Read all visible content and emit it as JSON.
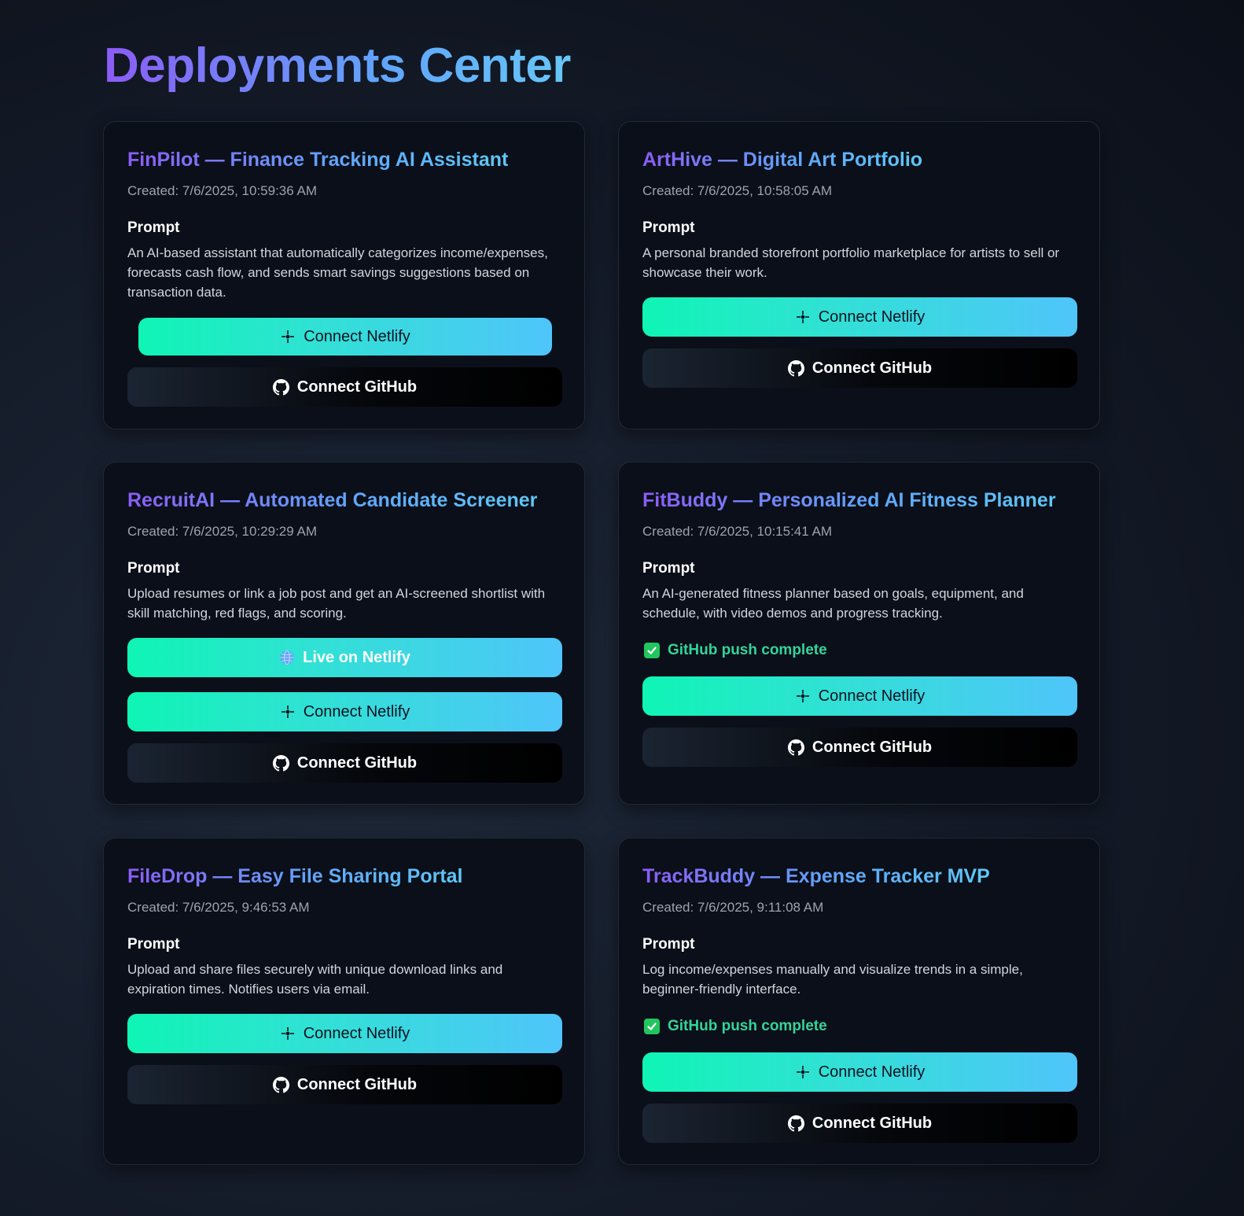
{
  "header": {
    "title": "Deployments Center"
  },
  "labels": {
    "prompt": "Prompt",
    "connect_netlify": "Connect Netlify",
    "connect_github": "Connect GitHub",
    "live_on_netlify": "Live on Netlify",
    "github_push_complete": "GitHub push complete"
  },
  "icons": {
    "netlify": "sparkle-icon",
    "github": "github-icon",
    "live": "globe-icon",
    "status": "checkmark-icon"
  },
  "colors": {
    "accent_green": "#34d399",
    "netlify_gradient_start": "#0ff5b5",
    "netlify_gradient_end": "#4fc5fa",
    "title_gradient_start": "#8b5cf6",
    "title_gradient_end": "#60a5fa"
  },
  "projects": [
    {
      "title": "FinPilot — Finance Tracking AI Assistant",
      "created": "Created: 7/6/2025, 10:59:36 AM",
      "prompt": "An AI-based assistant that automatically categorizes income/expenses, forecasts cash flow, and sends smart savings suggestions based on transaction data."
    },
    {
      "title": "ArtHive — Digital Art Portfolio",
      "created": "Created: 7/6/2025, 10:58:05 AM",
      "prompt": "A personal branded storefront portfolio marketplace for artists to sell or showcase their work."
    },
    {
      "title": "RecruitAI — Automated Candidate Screener",
      "created": "Created: 7/6/2025, 10:29:29 AM",
      "prompt": "Upload resumes or link a job post and get an AI-screened shortlist with skill matching, red flags, and scoring."
    },
    {
      "title": "FitBuddy — Personalized AI Fitness Planner",
      "created": "Created: 7/6/2025, 10:15:41 AM",
      "prompt": "An AI-generated fitness planner based on goals, equipment, and schedule, with video demos and progress tracking."
    },
    {
      "title": "FileDrop — Easy File Sharing Portal",
      "created": "Created: 7/6/2025, 9:46:53 AM",
      "prompt": "Upload and share files securely with unique download links and expiration times. Notifies users via email."
    },
    {
      "title": "TrackBuddy — Expense Tracker MVP",
      "created": "Created: 7/6/2025, 9:11:08 AM",
      "prompt": "Log income/expenses manually and visualize trends in a simple, beginner-friendly interface."
    }
  ]
}
